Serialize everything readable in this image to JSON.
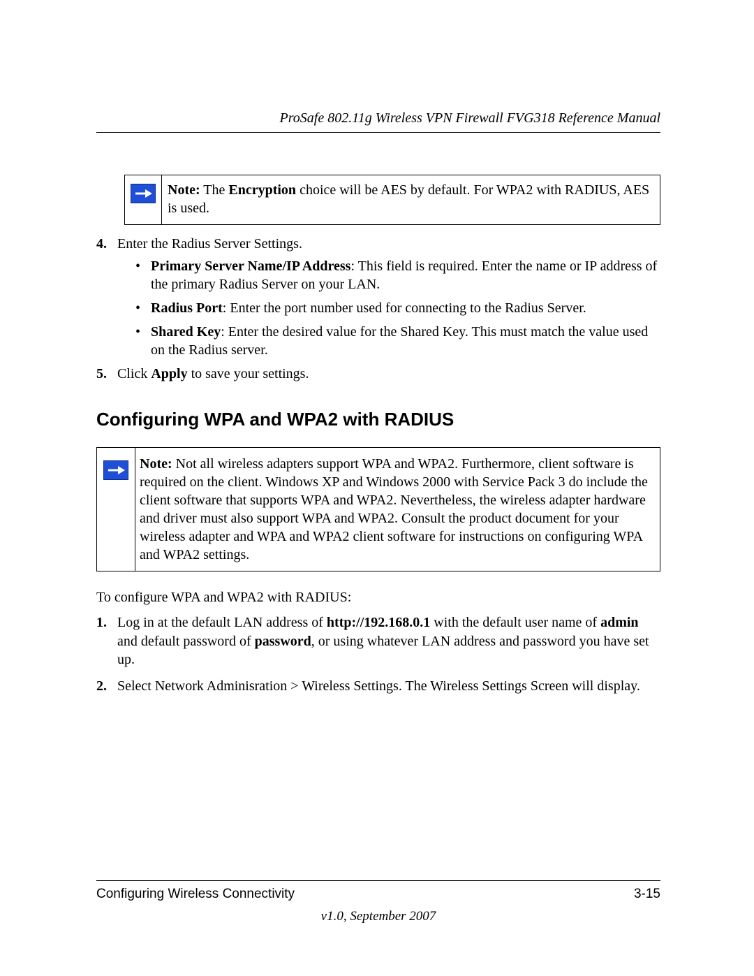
{
  "header": {
    "title": "ProSafe 802.11g Wireless VPN Firewall FVG318 Reference Manual"
  },
  "note1": {
    "label": "Note:",
    "before_bold": " The ",
    "bold": "Encryption",
    "after_bold": " choice will be AES by default. For WPA2 with RADIUS, AES is used."
  },
  "steps_upper": {
    "s4": {
      "intro": "Enter the Radius Server Settings.",
      "bullets": [
        {
          "bold": "Primary Server Name/IP Address",
          "rest": ": This field is required. Enter the name or IP address of the primary Radius Server on your LAN."
        },
        {
          "bold": "Radius Port",
          "rest": ": Enter the port number used for connecting to the Radius Server."
        },
        {
          "bold": "Shared Key",
          "rest": ": Enter the desired value for the Shared Key. This must match the value used on the Radius server."
        }
      ]
    },
    "s5": {
      "before": "Click ",
      "bold": "Apply",
      "after": " to save your settings."
    }
  },
  "section_heading": "Configuring WPA and WPA2 with RADIUS",
  "note2": {
    "label": "Note:",
    "text": " Not all wireless adapters support WPA and WPA2. Furthermore, client software is required on the client. Windows XP and Windows 2000 with Service Pack 3 do include the client software that supports WPA and WPA2. Nevertheless, the wireless adapter hardware and driver must also support WPA and WPA2. Consult the product document for your wireless adapter and WPA and WPA2 client software for instructions on configuring WPA and WPA2 settings."
  },
  "config_intro": "To configure WPA and WPA2 with RADIUS:",
  "steps_lower": {
    "s1": {
      "p1": "Log in at the default LAN address of ",
      "b1": "http://192.168.0.1",
      "p2": " with the default user name of ",
      "b2": "admin",
      "p3": " and default password of ",
      "b3": "password",
      "p4": ", or using whatever LAN address and password you have set up."
    },
    "s2": "Select Network Adminisration > Wireless Settings. The Wireless Settings Screen will display."
  },
  "footer": {
    "left": "Configuring Wireless Connectivity",
    "right": "3-15",
    "version": "v1.0, September 2007"
  }
}
